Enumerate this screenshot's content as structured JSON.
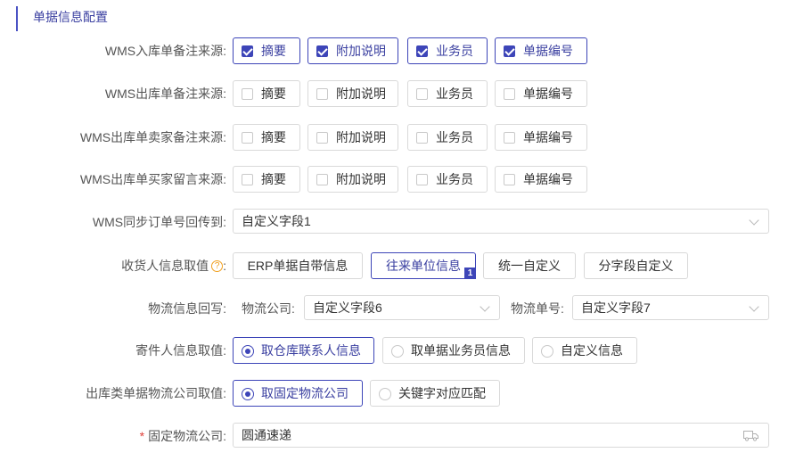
{
  "section_title": "单据信息配置",
  "wms_in_remark": {
    "label": "WMS入库单备注来源",
    "options": [
      {
        "label": "摘要",
        "checked": true
      },
      {
        "label": "附加说明",
        "checked": true
      },
      {
        "label": "业务员",
        "checked": true
      },
      {
        "label": "单据编号",
        "checked": true
      }
    ]
  },
  "wms_out_remark": {
    "label": "WMS出库单备注来源",
    "options": [
      {
        "label": "摘要",
        "checked": false
      },
      {
        "label": "附加说明",
        "checked": false
      },
      {
        "label": "业务员",
        "checked": false
      },
      {
        "label": "单据编号",
        "checked": false
      }
    ]
  },
  "wms_out_seller_remark": {
    "label": "WMS出库单卖家备注来源",
    "options": [
      {
        "label": "摘要",
        "checked": false
      },
      {
        "label": "附加说明",
        "checked": false
      },
      {
        "label": "业务员",
        "checked": false
      },
      {
        "label": "单据编号",
        "checked": false
      }
    ]
  },
  "wms_out_buyer_msg": {
    "label": "WMS出库单买家留言来源",
    "options": [
      {
        "label": "摘要",
        "checked": false
      },
      {
        "label": "附加说明",
        "checked": false
      },
      {
        "label": "业务员",
        "checked": false
      },
      {
        "label": "单据编号",
        "checked": false
      }
    ]
  },
  "wms_sync_order": {
    "label": "WMS同步订单号回传到",
    "value": "自定义字段1"
  },
  "receiver_info": {
    "label": "收货人信息取值",
    "help_icon": "question-circle-icon",
    "buttons": [
      {
        "label": "ERP单据自带信息",
        "active": false
      },
      {
        "label": "往来单位信息",
        "active": true,
        "badge": "1"
      },
      {
        "label": "统一自定义",
        "active": false
      },
      {
        "label": "分字段自定义",
        "active": false
      }
    ]
  },
  "logistics_writeback": {
    "label": "物流信息回写",
    "company_label": "物流公司",
    "company_value": "自定义字段6",
    "tracking_label": "物流单号",
    "tracking_value": "自定义字段7"
  },
  "sender_info": {
    "label": "寄件人信息取值",
    "options": [
      {
        "label": "取仓库联系人信息",
        "checked": true
      },
      {
        "label": "取单据业务员信息",
        "checked": false
      },
      {
        "label": "自定义信息",
        "checked": false
      }
    ]
  },
  "outbound_logistics_company": {
    "label": "出库类单据物流公司取值",
    "options": [
      {
        "label": "取固定物流公司",
        "checked": true
      },
      {
        "label": "关键字对应匹配",
        "checked": false
      }
    ]
  },
  "fixed_logistics_company": {
    "label": "固定物流公司",
    "required_mark": "*",
    "value": "圆通速递",
    "icon": "truck-icon"
  },
  "colors": {
    "accent": "#3d45b8",
    "required": "#e0413a",
    "help": "#f0a020"
  }
}
